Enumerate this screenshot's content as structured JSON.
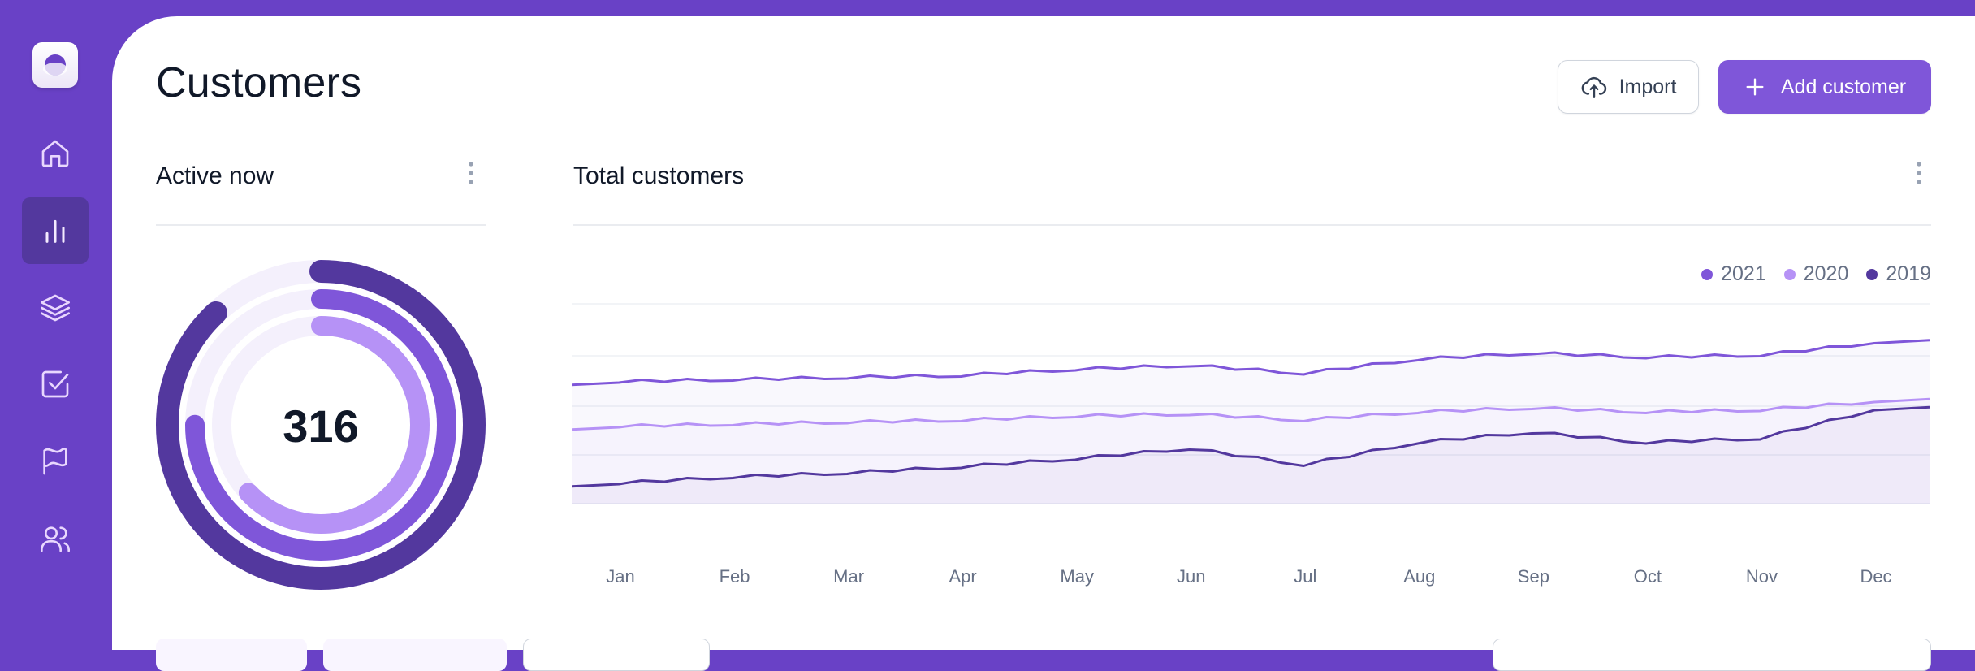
{
  "header": {
    "title": "Customers",
    "import_label": "Import",
    "add_label": "Add customer"
  },
  "sidebar": {
    "items": [
      {
        "icon": "home-icon",
        "active": false
      },
      {
        "icon": "bar-chart-icon",
        "active": true
      },
      {
        "icon": "layers-icon",
        "active": false
      },
      {
        "icon": "check-square-icon",
        "active": false
      },
      {
        "icon": "flag-icon",
        "active": false
      },
      {
        "icon": "users-icon",
        "active": false
      }
    ]
  },
  "active_now": {
    "title": "Active now",
    "value": "316"
  },
  "total_customers": {
    "title": "Total customers"
  },
  "colors": {
    "primary": "#7F56D9",
    "sidebar": "#6941C6",
    "dark": "#53389E",
    "light": "#B692F6"
  },
  "chart_data": [
    {
      "type": "pie",
      "title": "Active now",
      "center_label": "316",
      "series": [
        {
          "fraction": 0.88,
          "color": "#53389E"
        },
        {
          "fraction": 0.75,
          "color": "#7F56D9"
        },
        {
          "fraction": 0.63,
          "color": "#B692F6"
        }
      ]
    },
    {
      "type": "line",
      "title": "Total customers",
      "categories": [
        "Jan",
        "Feb",
        "Mar",
        "Apr",
        "May",
        "Jun",
        "Jul",
        "Aug",
        "Sep",
        "Oct",
        "Nov",
        "Dec"
      ],
      "ylim": [
        0,
        10
      ],
      "grid": true,
      "legend": "top-right",
      "series": [
        {
          "name": "2021",
          "color": "#7F56D9",
          "values": [
            6.0,
            6.1,
            6.2,
            6.3,
            6.6,
            6.8,
            6.4,
            7.1,
            7.4,
            7.2,
            7.3,
            7.9
          ]
        },
        {
          "name": "2020",
          "color": "#B692F6",
          "values": [
            3.8,
            3.9,
            4.0,
            4.1,
            4.3,
            4.4,
            4.1,
            4.5,
            4.7,
            4.5,
            4.6,
            5.0
          ]
        },
        {
          "name": "2019",
          "color": "#53389E",
          "values": [
            1.0,
            1.3,
            1.5,
            1.8,
            2.2,
            2.7,
            1.9,
            3.0,
            3.5,
            3.0,
            3.2,
            4.6
          ]
        }
      ]
    }
  ]
}
